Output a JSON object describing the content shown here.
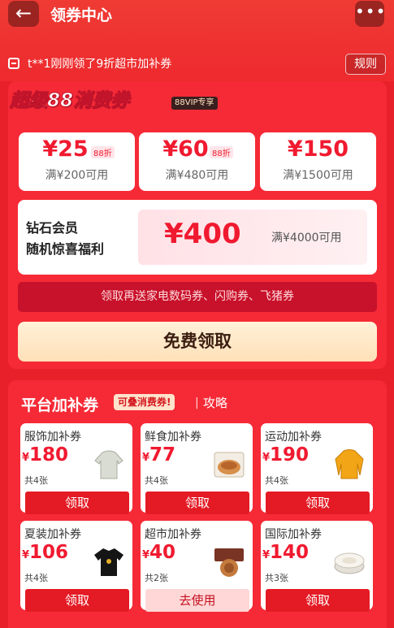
{
  "header": {
    "back_icon": "arrow-left-icon",
    "title": "领券中心",
    "more_icon": "ellipsis-icon"
  },
  "ticker": {
    "text": "t**1刚刚领了9折超市加补券",
    "rules_label": "规则"
  },
  "promo": {
    "title": "超级88消费券",
    "vip_tag": "88VIP专享",
    "coupons": [
      {
        "amount": "¥25",
        "tag": "88折",
        "condition": "满¥200可用"
      },
      {
        "amount": "¥60",
        "tag": "88折",
        "condition": "满¥480可用"
      },
      {
        "amount": "¥150",
        "tag": "",
        "condition": "满¥1500可用"
      }
    ],
    "diamond": {
      "line1": "钻石会员",
      "line2": "随机惊喜福利",
      "amount": "¥400",
      "condition": "满¥4000可用"
    },
    "extra_text": "领取再送家电数码券、闪购券、飞猪券",
    "claim_label": "免费领取"
  },
  "platform": {
    "title": "平台加补券",
    "stack_tag": "可叠消费券!",
    "separator": "|",
    "strategy_link": "攻略",
    "categories": [
      {
        "name": "服饰加补券",
        "yen": "¥",
        "amount": "180",
        "qty": "共4张",
        "button": "领取",
        "icon": "hoodie-icon"
      },
      {
        "name": "鲜食加补券",
        "yen": "¥",
        "amount": "77",
        "qty": "共4张",
        "button": "领取",
        "icon": "bread-icon"
      },
      {
        "name": "运动加补券",
        "yen": "¥",
        "amount": "190",
        "qty": "共4张",
        "button": "领取",
        "icon": "jacket-icon"
      },
      {
        "name": "夏装加补券",
        "yen": "¥",
        "amount": "106",
        "qty": "共4张",
        "button": "领取",
        "icon": "tshirt-icon"
      },
      {
        "name": "超市加补券",
        "yen": "¥",
        "amount": "40",
        "qty": "共2张",
        "button": "去使用",
        "icon": "mooncake-icon"
      },
      {
        "name": "国际加补券",
        "yen": "¥",
        "amount": "140",
        "qty": "共3张",
        "button": "领取",
        "icon": "powder-compact-icon"
      }
    ]
  }
}
